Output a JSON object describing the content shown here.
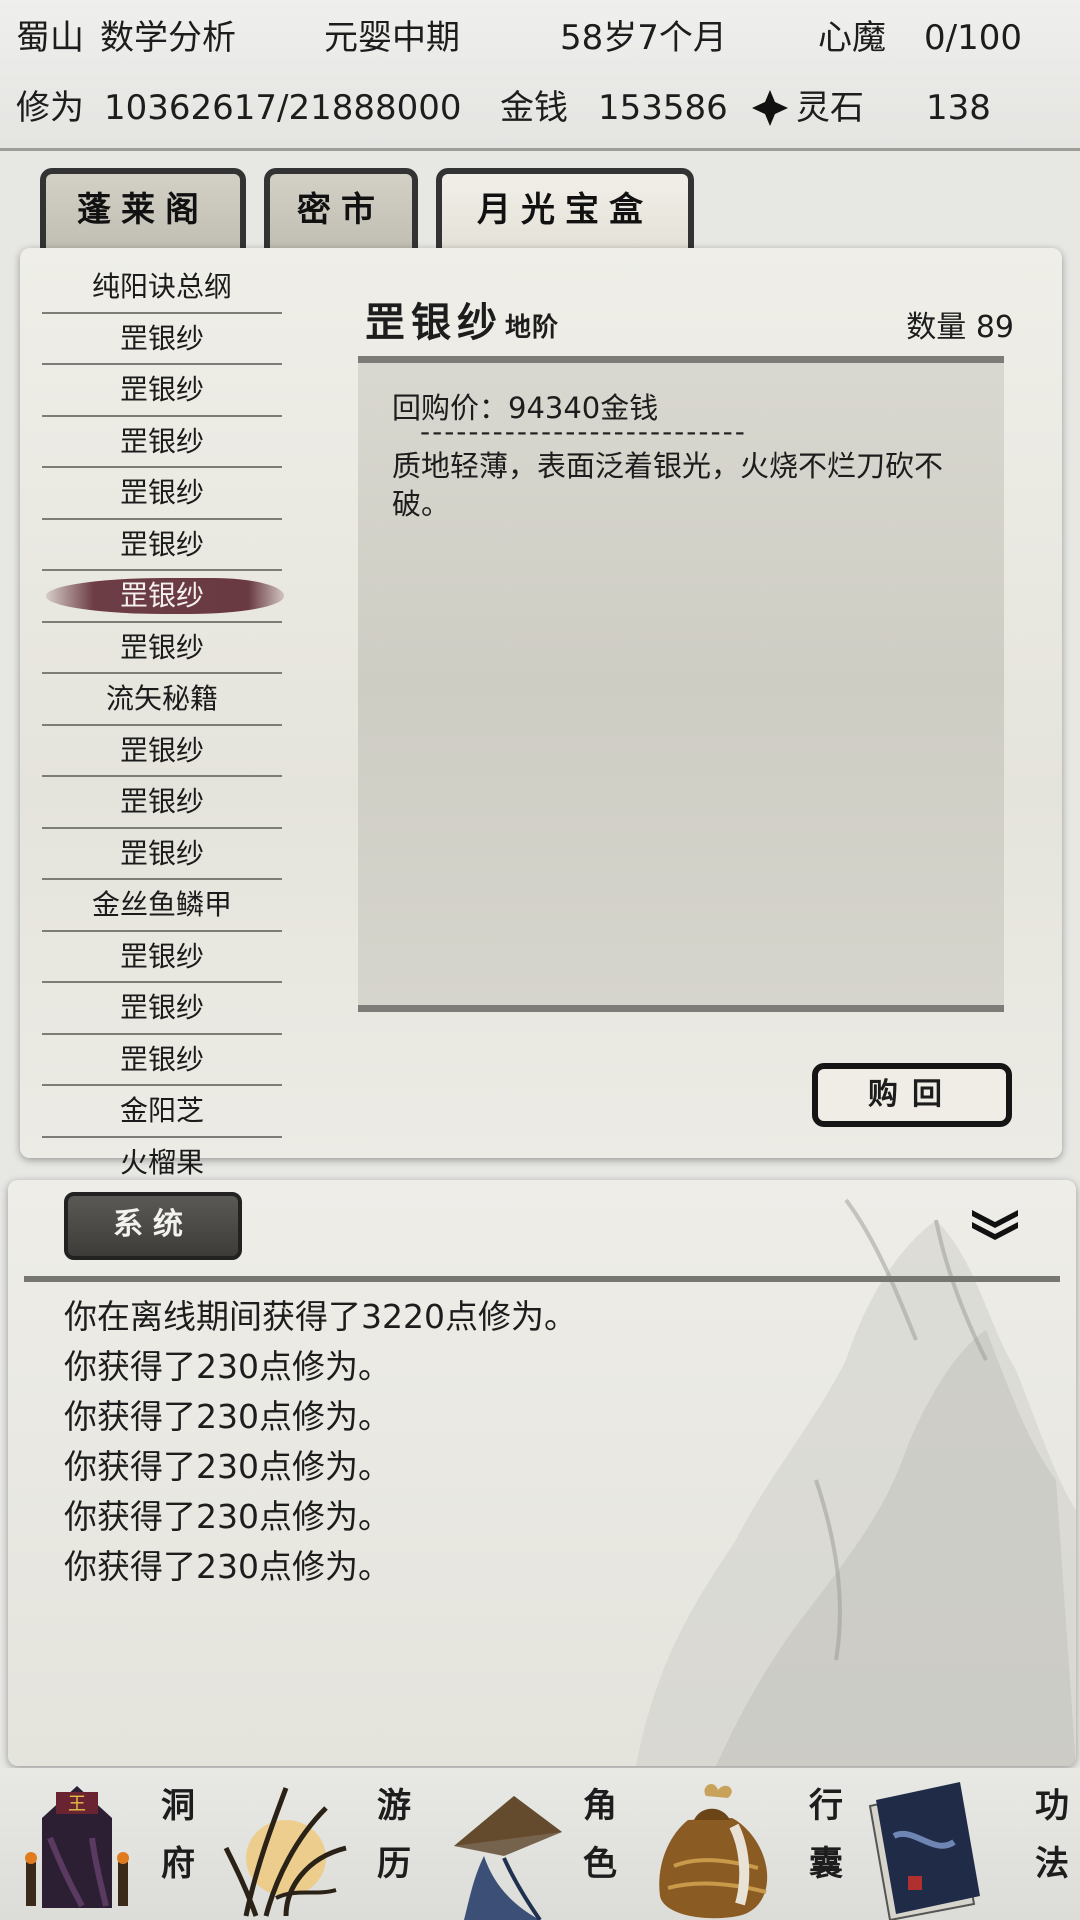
{
  "status": {
    "location": "蜀山",
    "character": "数学分析",
    "realm": "元婴中期",
    "age": "58岁7个月",
    "demon_label": "心魔",
    "demon_value": "0/100",
    "cultivation_label": "修为",
    "cultivation_value": "10362617/21888000",
    "money_label": "金钱",
    "money_value": "153586",
    "spirit_stone_label": "灵石",
    "spirit_stone_value": "138"
  },
  "tabs": [
    "蓬莱阁",
    "密市",
    "月光宝盒"
  ],
  "active_tab": "月光宝盒",
  "items": [
    "纯阳诀总纲",
    "罡银纱",
    "罡银纱",
    "罡银纱",
    "罡银纱",
    "罡银纱",
    "罡银纱",
    "罡银纱",
    "流矢秘籍",
    "罡银纱",
    "罡银纱",
    "罡银纱",
    "金丝鱼鳞甲",
    "罡银纱",
    "罡银纱",
    "罡银纱",
    "金阳芝",
    "火榴果"
  ],
  "selected_item": "罡银纱",
  "detail": {
    "name": "罡银纱",
    "grade": "地阶",
    "quantity_label": "数量",
    "quantity": "89",
    "buyback_price": "回购价：94340金钱",
    "divider": "---------------------------",
    "description": "质地轻薄，表面泛着银光，火烧不烂刀砍不破。",
    "buy_button": "购回"
  },
  "messages_tab": "系统",
  "messages": [
    "你在离线期间获得了3220点修为。",
    "你获得了230点修为。",
    "你获得了230点修为。",
    "你获得了230点修为。",
    "你获得了230点修为。",
    "你获得了230点修为。"
  ],
  "nav": [
    {
      "label1": "洞",
      "label2": "府",
      "icon": "cave-residence-icon"
    },
    {
      "label1": "游",
      "label2": "历",
      "icon": "travel-grass-icon"
    },
    {
      "label1": "角",
      "label2": "色",
      "icon": "character-hat-icon"
    },
    {
      "label1": "行",
      "label2": "囊",
      "icon": "bag-icon"
    },
    {
      "label1": "功",
      "label2": "法",
      "icon": "scripture-book-icon"
    }
  ],
  "colors": {
    "selection": "#6d3d46",
    "panel": "#eceae3",
    "border": "#333333"
  }
}
